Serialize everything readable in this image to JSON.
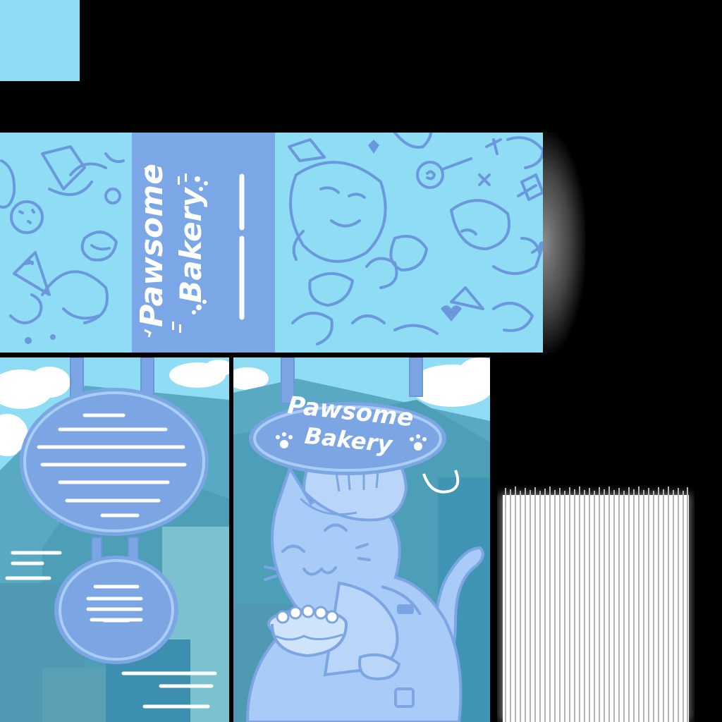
{
  "brand": {
    "name": "Pawsome Bakery",
    "line_1": "Pawsome",
    "line_2": "Bakery"
  },
  "palette": {
    "sky": "#8fdcf5",
    "band": "#7ba7e6",
    "doodle": "#6b98dd",
    "sign": "#7ba5e3",
    "sign_ring": "#a9cdf5",
    "cat": "#a9cbf7",
    "teal": "#4d9fb8",
    "white": "#ffffff"
  },
  "icons": {
    "decor": [
      "cat-face-icon",
      "cookie-icon",
      "cupcake-icon",
      "lollipop-icon",
      "bow-icon",
      "heart-icon",
      "paw-icon",
      "cake-icon"
    ]
  }
}
